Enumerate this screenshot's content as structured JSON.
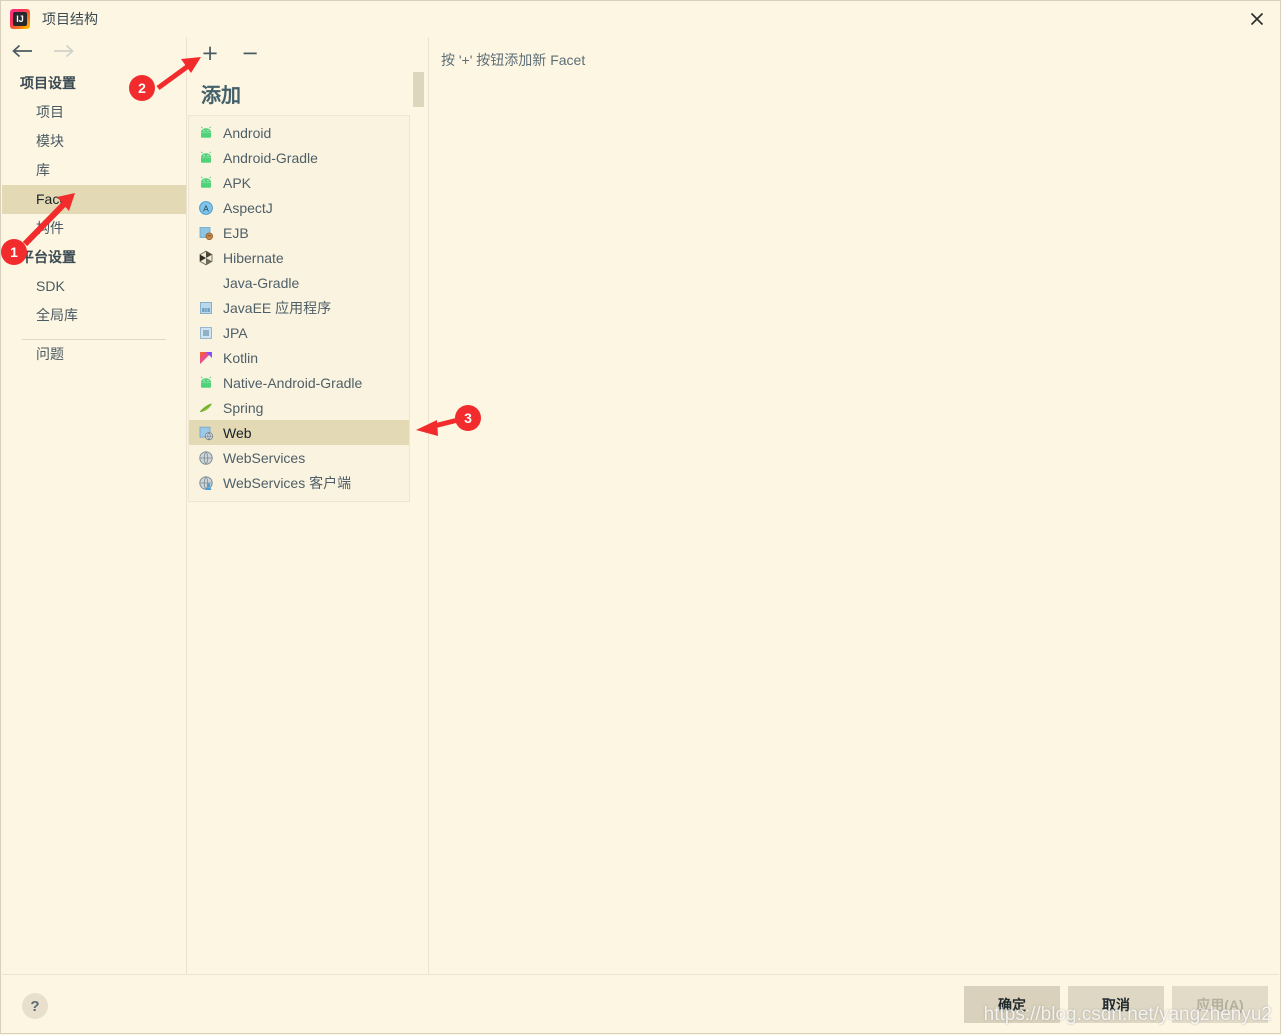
{
  "window": {
    "title": "项目结构",
    "app_icon": "intellij-idea-icon",
    "close_icon": "close-icon"
  },
  "nav": {
    "back_icon": "arrow-left-icon",
    "forward_icon": "arrow-right-icon"
  },
  "sidebar": {
    "groups": [
      {
        "title": "项目设置",
        "items": [
          {
            "label": "项目",
            "selected": false
          },
          {
            "label": "模块",
            "selected": false
          },
          {
            "label": "库",
            "selected": false
          },
          {
            "label": "Facet",
            "selected": true
          },
          {
            "label": "构件",
            "selected": false
          }
        ]
      },
      {
        "title": "平台设置",
        "items": [
          {
            "label": "SDK",
            "selected": false
          },
          {
            "label": "全局库",
            "selected": false
          }
        ]
      }
    ],
    "footer_items": [
      {
        "label": "问题",
        "selected": false
      }
    ]
  },
  "facet_toolbar": {
    "add_label": "+",
    "add_name": "plus-icon",
    "remove_label": "−",
    "remove_name": "minus-icon"
  },
  "add_popup": {
    "heading": "添加",
    "items": [
      {
        "label": "Android",
        "icon": "android-icon",
        "selected": false
      },
      {
        "label": "Android-Gradle",
        "icon": "android-icon",
        "selected": false
      },
      {
        "label": "APK",
        "icon": "android-icon",
        "selected": false
      },
      {
        "label": "AspectJ",
        "icon": "aspectj-icon",
        "selected": false
      },
      {
        "label": "EJB",
        "icon": "ejb-icon",
        "selected": false
      },
      {
        "label": "Hibernate",
        "icon": "hibernate-icon",
        "selected": false
      },
      {
        "label": "Java-Gradle",
        "icon": "none",
        "selected": false
      },
      {
        "label": "JavaEE 应用程序",
        "icon": "javaee-icon",
        "selected": false
      },
      {
        "label": "JPA",
        "icon": "jpa-icon",
        "selected": false
      },
      {
        "label": "Kotlin",
        "icon": "kotlin-icon",
        "selected": false
      },
      {
        "label": "Native-Android-Gradle",
        "icon": "android-icon",
        "selected": false
      },
      {
        "label": "Spring",
        "icon": "spring-icon",
        "selected": false
      },
      {
        "label": "Web",
        "icon": "web-icon",
        "selected": true
      },
      {
        "label": "WebServices",
        "icon": "webservices-icon",
        "selected": false
      },
      {
        "label": "WebServices 客户端",
        "icon": "webservices-client-icon",
        "selected": false
      }
    ]
  },
  "detail": {
    "hint": "按 '+' 按钮添加新 Facet"
  },
  "bottom": {
    "help_label": "?",
    "buttons": [
      {
        "label": "确定",
        "state": "default"
      },
      {
        "label": "取消",
        "state": "normal"
      },
      {
        "label": "应用(A)",
        "state": "disabled"
      }
    ]
  },
  "annotations": {
    "markers": [
      {
        "number": "1"
      },
      {
        "number": "2"
      },
      {
        "number": "3"
      }
    ]
  },
  "watermark": {
    "text": "https://blog.csdn.net/yangzhenyu2"
  },
  "colors": {
    "background": "#fdf6e3",
    "selection": "#e3d9b4",
    "accent_red": "#f22c2c",
    "text": "#4e5f67",
    "button": "#d9d1bb"
  }
}
